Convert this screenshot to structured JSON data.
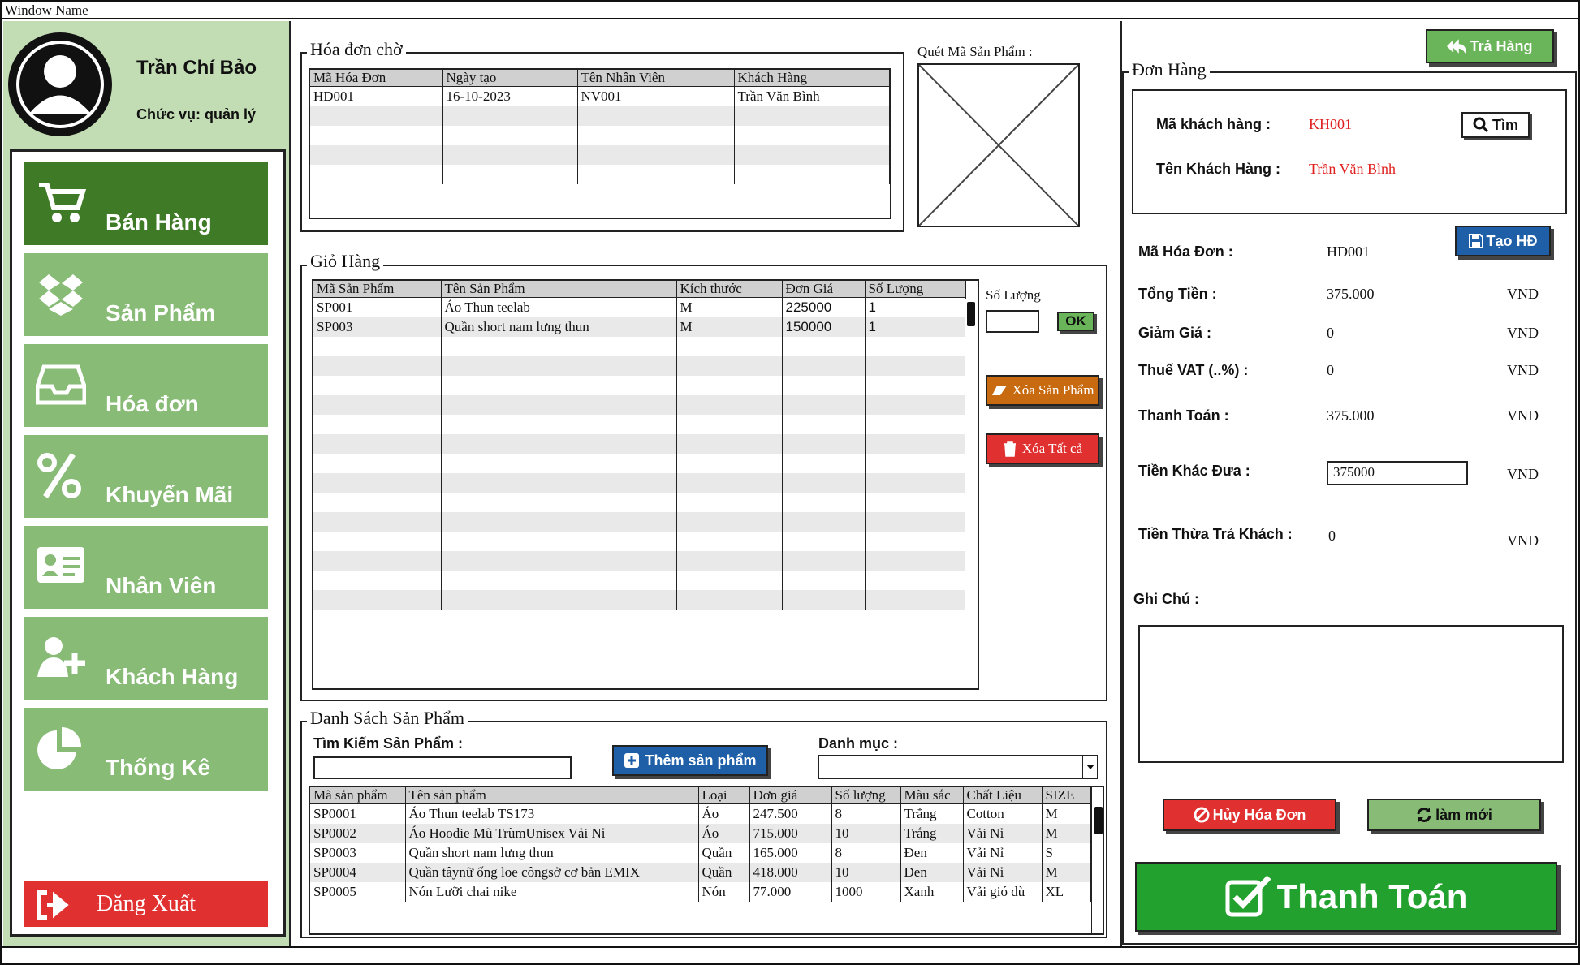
{
  "window": {
    "title": "Window Name"
  },
  "user": {
    "name": "Trần Chí Bảo",
    "role": "Chức vụ: quản lý"
  },
  "nav": {
    "items": [
      {
        "label": "Bán Hàng",
        "icon": "cart-icon"
      },
      {
        "label": "Sản Phẩm",
        "icon": "dropbox-icon"
      },
      {
        "label": "Hóa đơn",
        "icon": "inbox-icon"
      },
      {
        "label": "Khuyến Mãi",
        "icon": "percent-icon"
      },
      {
        "label": "Nhân Viên",
        "icon": "id-card-icon"
      },
      {
        "label": "Khách Hàng",
        "icon": "user-plus-icon"
      },
      {
        "label": "Thống Kê",
        "icon": "pie-chart-icon"
      }
    ],
    "logout": "Đăng Xuất"
  },
  "pending": {
    "title": "Hóa đơn chờ",
    "columns": [
      "Mã Hóa Đơn",
      "Ngày tạo",
      "Tên Nhân Viên",
      "Khách Hàng"
    ],
    "rows": [
      [
        "HD001",
        "16-10-2023",
        "NV001",
        "Trần Văn Bình"
      ],
      [
        "",
        "",
        "",
        ""
      ],
      [
        "",
        "",
        "",
        ""
      ],
      [
        "",
        "",
        "",
        ""
      ],
      [
        "",
        "",
        "",
        ""
      ]
    ]
  },
  "scan": {
    "label": "Quét Mã Sản Phẩm :"
  },
  "cart": {
    "title": "Giỏ Hàng",
    "columns": [
      "Mã Sản Phẩm",
      "Tên Sản Phẩm",
      "Kích thước",
      "Đơn Giá",
      "Số Lượng"
    ],
    "rows": [
      [
        "SP001",
        "Áo Thun teelab",
        "M",
        "225000",
        "1"
      ],
      [
        "SP003",
        "Quần short nam lưng thun",
        "M",
        "150000",
        "1"
      ],
      [
        "",
        "",
        "",
        "",
        ""
      ],
      [
        "",
        "",
        "",
        "",
        ""
      ],
      [
        "",
        "",
        "",
        "",
        ""
      ],
      [
        "",
        "",
        "",
        "",
        ""
      ],
      [
        "",
        "",
        "",
        "",
        ""
      ],
      [
        "",
        "",
        "",
        "",
        ""
      ],
      [
        "",
        "",
        "",
        "",
        ""
      ],
      [
        "",
        "",
        "",
        "",
        ""
      ],
      [
        "",
        "",
        "",
        "",
        ""
      ],
      [
        "",
        "",
        "",
        "",
        ""
      ],
      [
        "",
        "",
        "",
        "",
        ""
      ],
      [
        "",
        "",
        "",
        "",
        ""
      ],
      [
        "",
        "",
        "",
        "",
        ""
      ],
      [
        "",
        "",
        "",
        "",
        ""
      ]
    ],
    "qty_label": "Số Lượng",
    "qty_value": "",
    "ok_label": "OK",
    "delete_label": "Xóa Sản Phẩm",
    "delete_all_label": "Xóa Tất cả"
  },
  "products": {
    "title": "Danh Sách Sản Phẩm",
    "search_label": "Tìm Kiếm Sản Phẩm :",
    "search_value": "",
    "add_label": "Thêm sản phẩm",
    "category_label": "Danh mục :",
    "category_value": "",
    "columns": [
      "Mã sản phẩm",
      "Tên sản phẩm",
      "Loại",
      "Đơn giá",
      "Số lượng",
      "Màu sắc",
      "Chất Liệu",
      "SIZE"
    ],
    "rows": [
      [
        "SP0001",
        "Áo Thun teelab TS173",
        "Áo",
        "247.500",
        "8",
        "Trắng",
        "Cotton",
        "M"
      ],
      [
        "SP0002",
        "Áo Hoodie Mũ TrùmUnisex Vải Nỉ",
        "Áo",
        "715.000",
        "10",
        "Trắng",
        "Vải Nỉ",
        "M"
      ],
      [
        "SP0003",
        "Quần short nam lưng thun",
        "Quần",
        "165.000",
        "8",
        "Đen",
        "Vải Nỉ",
        "S"
      ],
      [
        "SP0004",
        "Quần tâynữ ống loe côngsở cơ bản EMIX",
        "Quần",
        "418.000",
        "10",
        "Đen",
        "Vải Nỉ",
        "M"
      ],
      [
        "SP0005",
        "Nón Lưỡi chai nike",
        "Nón",
        "77.000",
        "1000",
        "Xanh",
        "Vải gió dù",
        "XL"
      ]
    ]
  },
  "order": {
    "return_label": "Trả Hàng",
    "title": "Đơn Hàng",
    "customer_id_label": "Mã khách hàng :",
    "customer_id": "KH001",
    "search_label": "Tìm",
    "customer_name_label": "Tên Khách Hàng :",
    "customer_name": "Trần Văn Bình",
    "create_label": "Tạo HĐ",
    "invoice_id_label": "Mã Hóa Đơn :",
    "invoice_id": "HD001",
    "total_label": "Tổng Tiền :",
    "total": "375.000",
    "discount_label": "Giảm Giá :",
    "discount": "0",
    "vat_label": "Thuế VAT (..%) :",
    "vat": "0",
    "pay_label": "Thanh Toán :",
    "pay": "375.000",
    "given_label": "Tiền Khác Đưa :",
    "given": "375000",
    "change_label": "Tiền Thừa Trả Khách :",
    "change": "0",
    "currency": "VND",
    "note_label": "Ghi Chú :",
    "note": "",
    "cancel_label": "Hủy Hóa Đơn",
    "refresh_label": "làm mới",
    "checkout_label": "Thanh Toán"
  },
  "colors": {
    "nav_active": "#3f7b26",
    "nav": "#87bb76",
    "sidebar": "#c2dcb3",
    "danger": "#e03030",
    "primary": "#1f5fa8",
    "success": "#22a12e",
    "accent_green": "#6ab55a",
    "orange": "#c86a10",
    "red_text": "#e02020"
  }
}
